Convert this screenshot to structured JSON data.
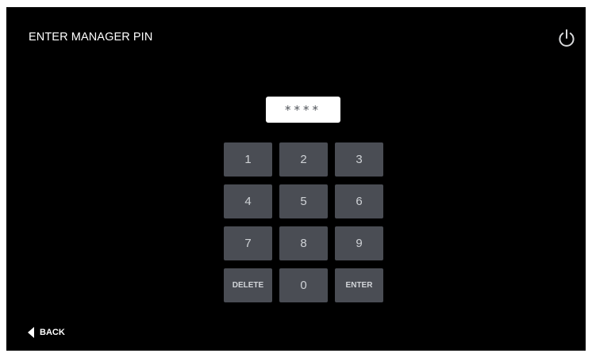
{
  "header": {
    "title": "ENTER MANAGER PIN",
    "power_icon": "power-icon"
  },
  "pin": {
    "masked_value": "****"
  },
  "keypad": {
    "keys": [
      "1",
      "2",
      "3",
      "4",
      "5",
      "6",
      "7",
      "8",
      "9",
      "DELETE",
      "0",
      "ENTER"
    ]
  },
  "footer": {
    "back_label": "BACK",
    "back_icon": "triangle-left-icon"
  },
  "colors": {
    "background": "#000000",
    "key": "#4a4d54",
    "pin_field": "#ffffff",
    "text": "#ffffff"
  }
}
